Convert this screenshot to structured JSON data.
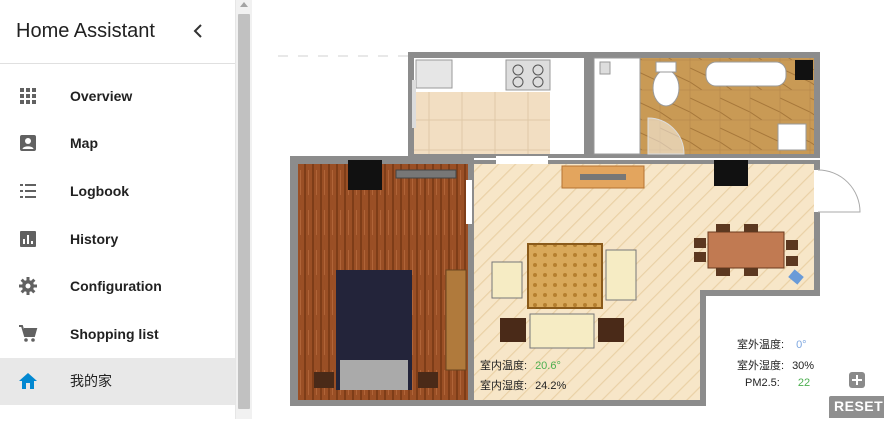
{
  "app": {
    "title": "Home Assistant"
  },
  "sidebar": {
    "items": [
      {
        "label": "Overview",
        "icon": "apps-grid-icon"
      },
      {
        "label": "Map",
        "icon": "account-box-icon"
      },
      {
        "label": "Logbook",
        "icon": "format-list-icon"
      },
      {
        "label": "History",
        "icon": "chart-bar-icon"
      },
      {
        "label": "Configuration",
        "icon": "gear-icon"
      },
      {
        "label": "Shopping list",
        "icon": "cart-icon"
      },
      {
        "label": "我的家",
        "icon": "home-icon",
        "active": true
      }
    ]
  },
  "floorplan": {
    "indoor_temp_label": "室内温度:",
    "indoor_temp_value": "20.6°",
    "indoor_humidity_label": "室内湿度:",
    "indoor_humidity_value": "24.2%",
    "outdoor_temp_label": "室外温度:",
    "outdoor_temp_value": "0°",
    "outdoor_humidity_label": "室外湿度:",
    "outdoor_humidity_value": "30%",
    "pm25_label": "PM2.5:",
    "pm25_value": "22",
    "reset_label": "RESET"
  },
  "colors": {
    "accent_blue": "#0288d1",
    "value_green": "#4caf50",
    "value_blue": "#7ea7e0",
    "wall": "#8c8c8c"
  }
}
